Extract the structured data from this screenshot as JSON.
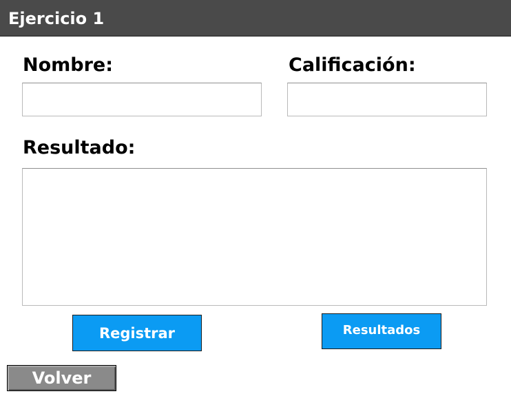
{
  "header": {
    "title": "Ejercicio 1"
  },
  "form": {
    "nombre_label": "Nombre:",
    "nombre_value": "",
    "calificacion_label": "Calificación:",
    "calificacion_value": "",
    "resultado_label": "Resultado:",
    "resultado_value": ""
  },
  "buttons": {
    "registrar": "Registrar",
    "resultados": "Resultados",
    "volver": "Volver"
  },
  "colors": {
    "title_bar": "#4a4a4a",
    "primary_button": "#0b9bf3",
    "back_button": "#8a8a8a"
  }
}
